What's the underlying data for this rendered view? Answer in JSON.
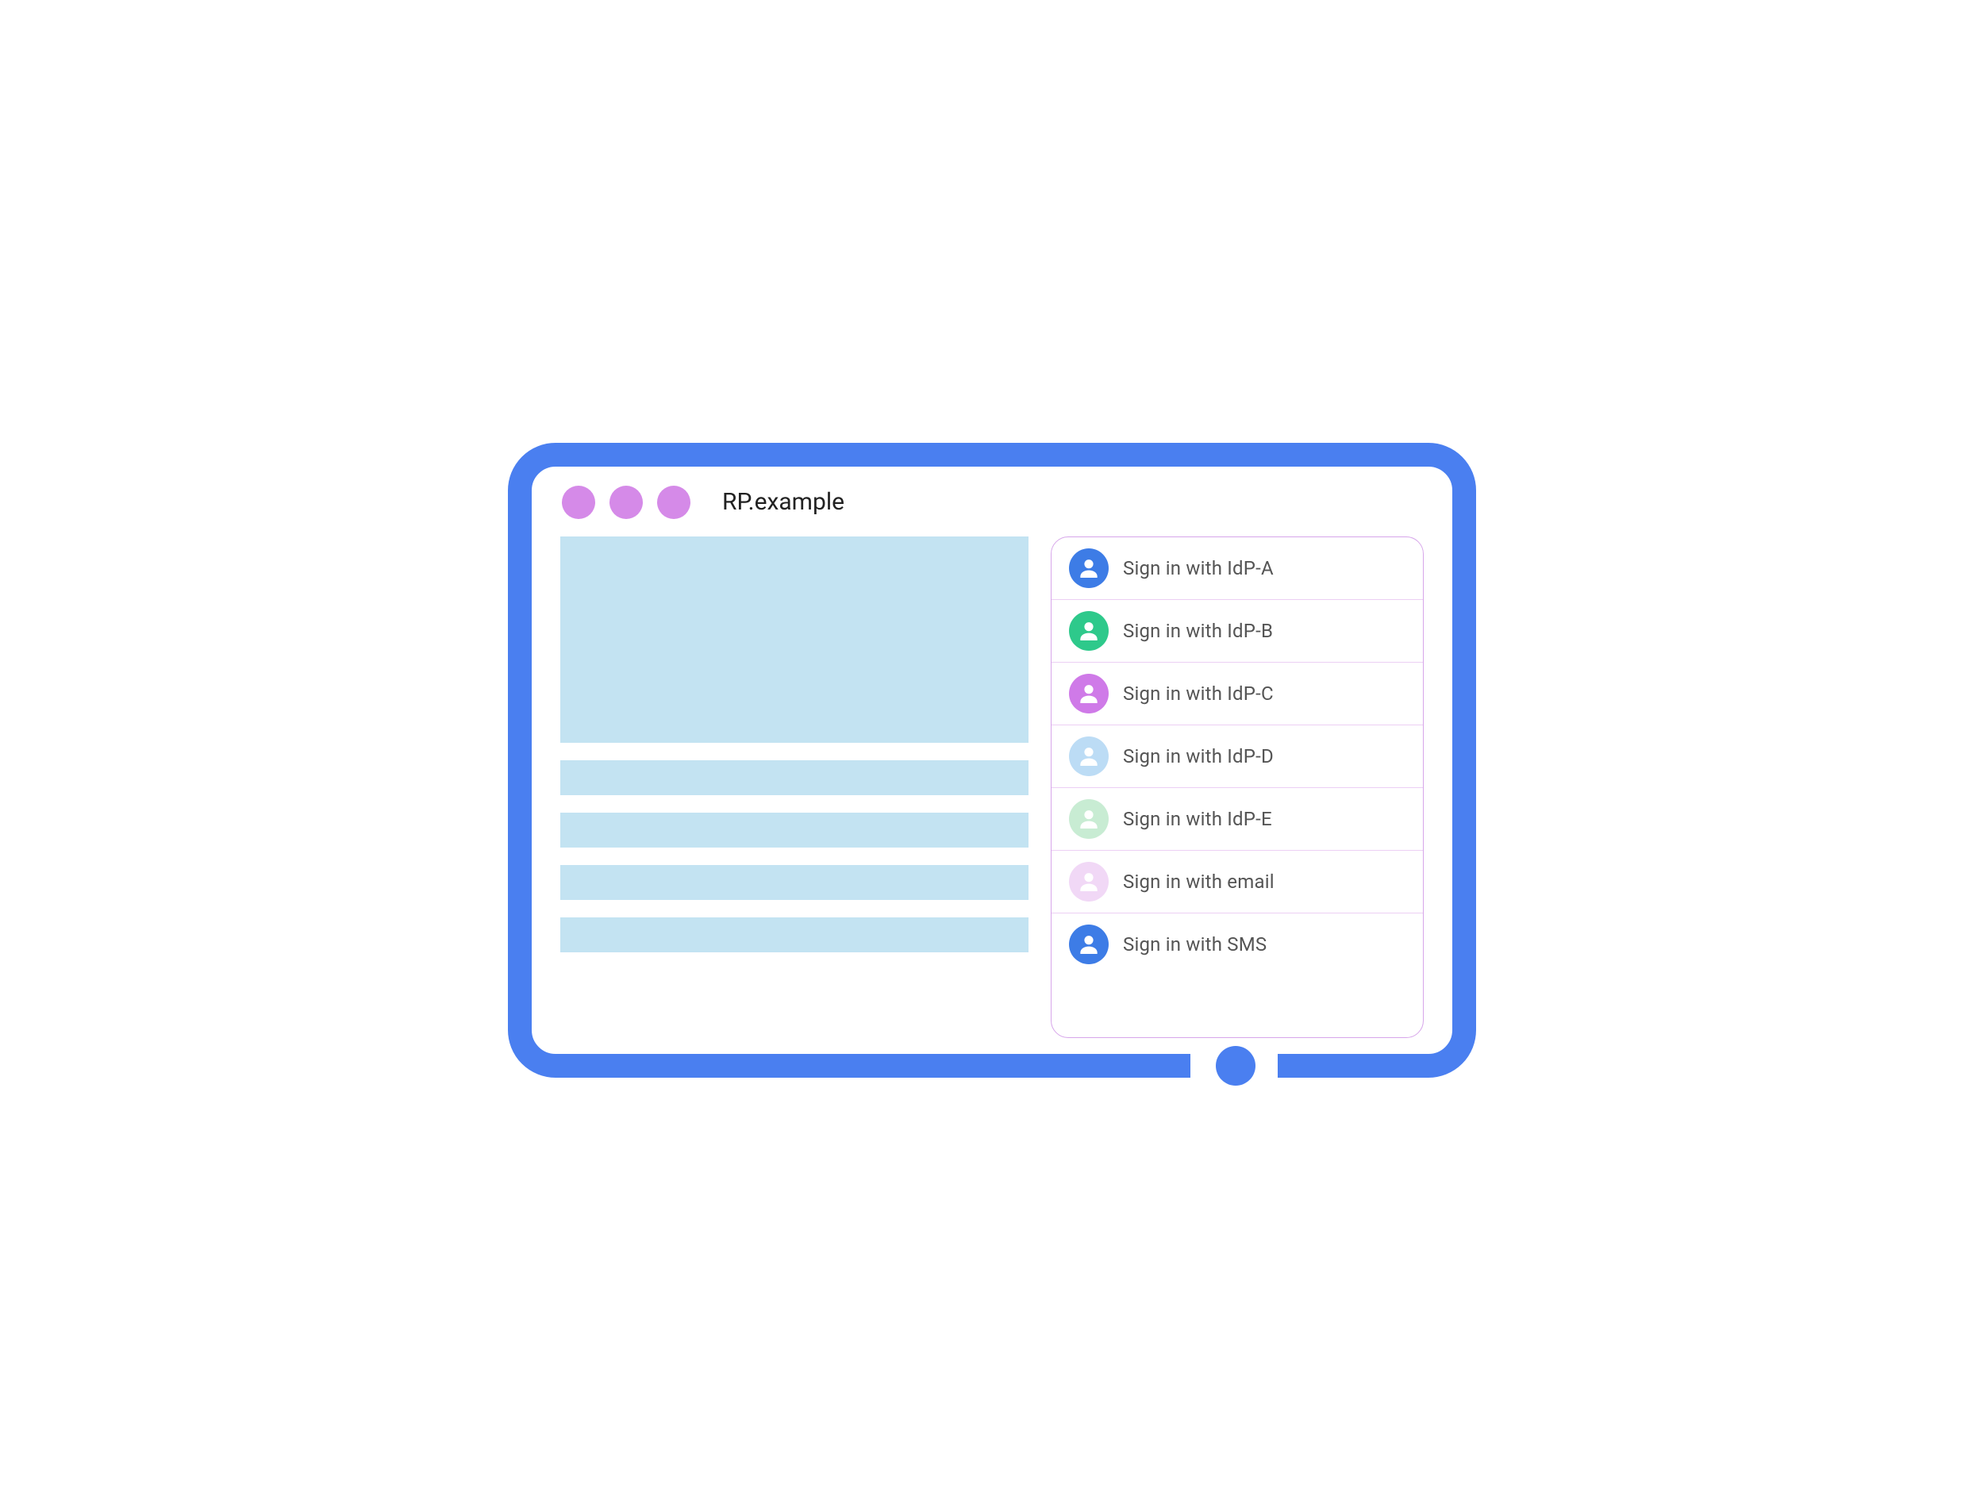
{
  "browser": {
    "title": "RP.example"
  },
  "signin": {
    "options": [
      {
        "label": "Sign in with IdP-A",
        "color": "#3d7ce6"
      },
      {
        "label": "Sign in with IdP-B",
        "color": "#2ec98b"
      },
      {
        "label": "Sign in with IdP-C",
        "color": "#cf7ae8"
      },
      {
        "label": "Sign in with IdP-D",
        "color": "#bcdcf5"
      },
      {
        "label": "Sign in with IdP-E",
        "color": "#c8ecd3"
      },
      {
        "label": "Sign in with email",
        "color": "#f1d8f6"
      },
      {
        "label": "Sign in with SMS",
        "color": "#3d7ce6"
      }
    ]
  },
  "colors": {
    "frame": "#4a7ff0",
    "titlebar_dot": "#d58ae8",
    "placeholder": "#c3e3f2",
    "panel_border": "#d7a6ea"
  }
}
